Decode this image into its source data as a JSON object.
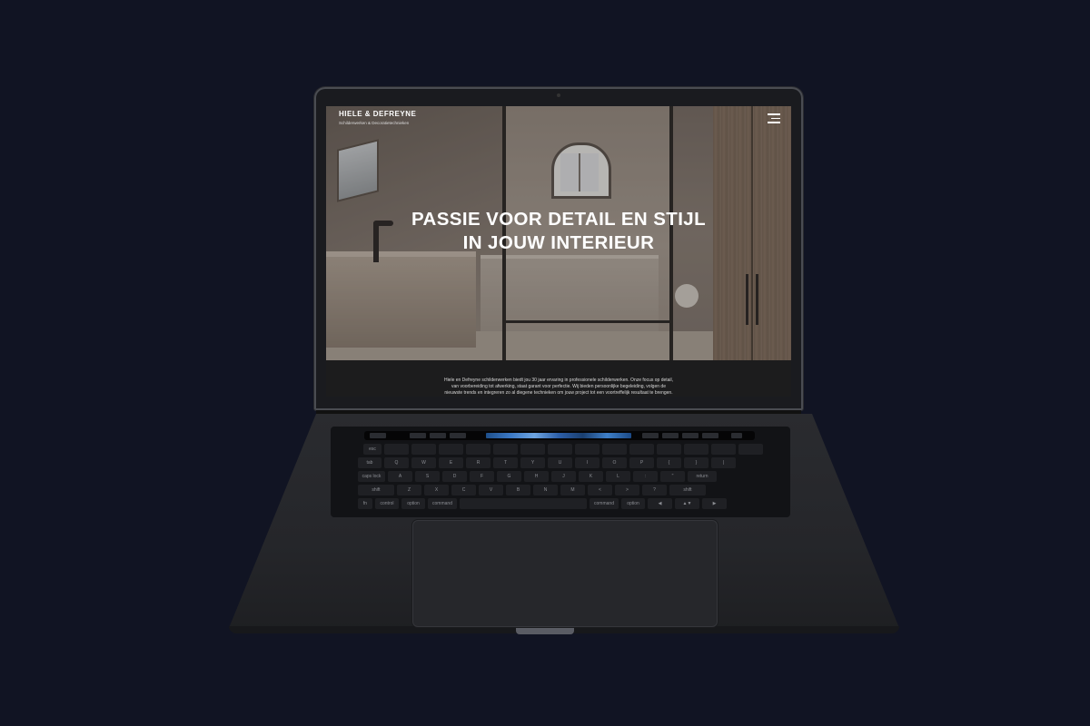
{
  "website": {
    "brand": "HIELE & DEFREYNE",
    "tagline": "Schilderwerken & Decoratietechnieken",
    "menu_icon": "hamburger-menu-icon",
    "headline_line1": "PASSIE VOOR DETAIL EN STIJL",
    "headline_line2": "IN JOUW INTERIEUR",
    "intro_line1": "Hiele en Defreyne schilderwerken biedt jou 30 jaar ervaring in professionele schilderwerken. Onze focus op detail,",
    "intro_line2": "van voorbereiding tot afwerking, staat garant voor perfectie. Wij bieden persoonlijke begeleiding, volgen de",
    "intro_line3": "nieuwste trends en integreren zo al diegene technieken om jouw project tot een voortreffelijk resultaat te brengen."
  },
  "keyboard": {
    "row1": [
      "esc",
      "",
      "",
      "",
      "",
      "",
      "",
      "",
      "",
      "",
      "",
      "",
      "",
      "",
      ""
    ],
    "row2": [
      "tab",
      "Q",
      "W",
      "E",
      "R",
      "T",
      "Y",
      "U",
      "I",
      "O",
      "P",
      "{",
      "}",
      "|"
    ],
    "row3": [
      "caps lock",
      "A",
      "S",
      "D",
      "F",
      "G",
      "H",
      "J",
      "K",
      "L",
      ":",
      "\"",
      "return"
    ],
    "row4": [
      "shift",
      "Z",
      "X",
      "C",
      "V",
      "B",
      "N",
      "M",
      "<",
      ">",
      "?",
      "shift"
    ],
    "row5": [
      "fn",
      "control",
      "option",
      "command",
      "",
      "command",
      "option",
      "◀",
      "▲▼",
      "▶"
    ]
  },
  "colors": {
    "background": "#111423",
    "laptop_body": "#25262a",
    "intro_band": "#1c1c1d"
  }
}
